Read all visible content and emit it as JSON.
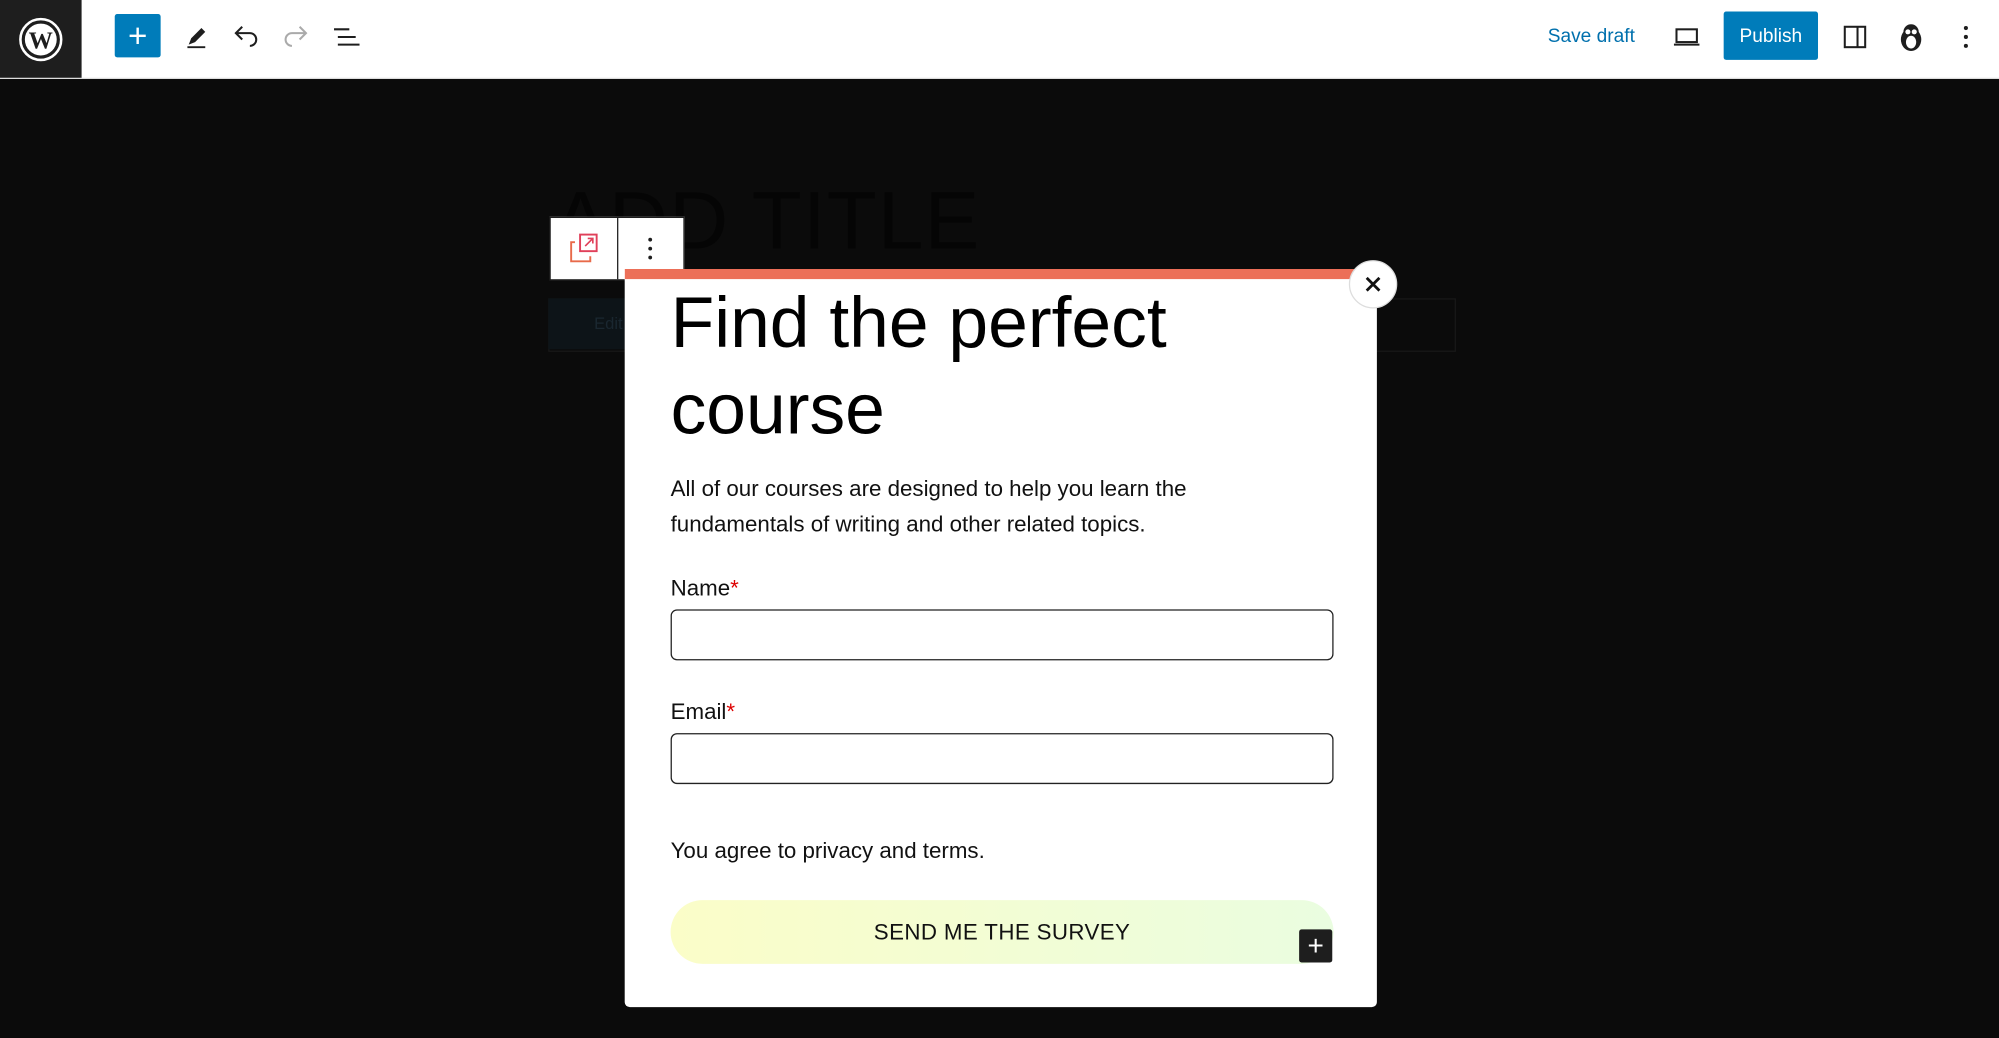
{
  "topbar": {
    "save_draft": "Save draft",
    "publish": "Publish",
    "icons": [
      "wordpress-logo",
      "plus-icon",
      "pencil-icon",
      "undo-icon",
      "redo-icon",
      "list-view-icon",
      "desktop-preview-icon",
      "sidebar-icon",
      "avatar-icon",
      "more-vertical-icon"
    ]
  },
  "canvas": {
    "title_placeholder": "ADD TITLE",
    "ghost_button": "Edit"
  },
  "popup": {
    "heading": "Find the perfect course",
    "description": "All of our courses are designed to help you learn the fundamentals of writing and other related topics.",
    "name_label": "Name",
    "email_label": "Email",
    "required_mark": "*",
    "agree": "You agree to privacy and terms.",
    "submit": "SEND ME THE SURVEY",
    "accent": "#ec6f58"
  },
  "colors": {
    "brand": "#007cba"
  }
}
